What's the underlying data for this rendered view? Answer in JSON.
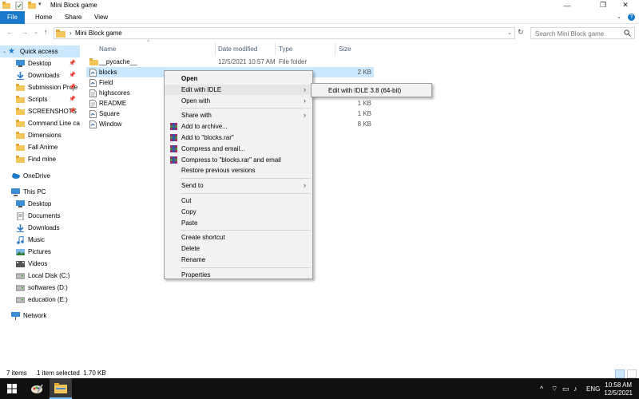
{
  "window": {
    "title": "Mini Block game",
    "controls": {
      "minimize": "—",
      "maximize": "❐",
      "close": "✕"
    }
  },
  "ribbon": {
    "tabs": [
      "File",
      "Home",
      "Share",
      "View"
    ],
    "help_icon": "?"
  },
  "address": {
    "path": "Mini Block game",
    "search_placeholder": "Search Mini Block game"
  },
  "nav": {
    "quick_access": "Quick access",
    "items": [
      {
        "label": "Desktop",
        "icon": "desktop-icon",
        "pinned": true
      },
      {
        "label": "Downloads",
        "icon": "download-icon",
        "pinned": true
      },
      {
        "label": "Submission Proje",
        "icon": "folder-icon",
        "pinned": true
      },
      {
        "label": "Scripts",
        "icon": "folder-icon",
        "pinned": true
      },
      {
        "label": "SCREENSHOTS",
        "icon": "folder-icon",
        "pinned": true
      },
      {
        "label": "Command Line calc",
        "icon": "folder-icon",
        "pinned": false
      },
      {
        "label": "Dimensions",
        "icon": "folder-icon",
        "pinned": false
      },
      {
        "label": "Fall Anime",
        "icon": "folder-icon",
        "pinned": false
      },
      {
        "label": "Find mine",
        "icon": "folder-icon",
        "pinned": false
      }
    ],
    "onedrive": "OneDrive",
    "this_pc": "This PC",
    "pc_items": [
      {
        "label": "Desktop",
        "icon": "desktop-icon"
      },
      {
        "label": "Documents",
        "icon": "documents-icon"
      },
      {
        "label": "Downloads",
        "icon": "download-icon"
      },
      {
        "label": "Music",
        "icon": "music-icon"
      },
      {
        "label": "Pictures",
        "icon": "pictures-icon"
      },
      {
        "label": "Videos",
        "icon": "videos-icon"
      },
      {
        "label": "Local Disk (C:)",
        "icon": "disk-icon"
      },
      {
        "label": "softwares (D:)",
        "icon": "disk-icon"
      },
      {
        "label": "education (E:)",
        "icon": "disk-icon"
      }
    ],
    "network": "Network"
  },
  "files": {
    "columns": [
      "Name",
      "Date modified",
      "Type",
      "Size"
    ],
    "rows": [
      {
        "name": "__pycache__",
        "date": "12/5/2021 10:57 AM",
        "type": "File folder",
        "size": "",
        "icon": "folder-icon"
      },
      {
        "name": "blocks",
        "date": "",
        "type": "",
        "size": "2 KB",
        "icon": "python-file-icon",
        "selected": true
      },
      {
        "name": "Field",
        "date": "",
        "type": "",
        "size": "",
        "icon": "python-file-icon"
      },
      {
        "name": "highscores",
        "date": "",
        "type": "",
        "size": "",
        "icon": "text-file-icon"
      },
      {
        "name": "README",
        "date": "",
        "type": "nt",
        "size": "1 KB",
        "icon": "text-file-icon"
      },
      {
        "name": "Square",
        "date": "",
        "type": "",
        "size": "1 KB",
        "icon": "python-file-icon"
      },
      {
        "name": "Window",
        "date": "",
        "type": "",
        "size": "8 KB",
        "icon": "python-file-icon"
      }
    ]
  },
  "context_menu": {
    "items": [
      {
        "label": "Open",
        "bold": true
      },
      {
        "label": "Edit with IDLE",
        "submenu": true,
        "highlighted": true
      },
      {
        "label": "Open with",
        "submenu": true
      },
      {
        "separator": true
      },
      {
        "label": "Share with",
        "submenu": true
      },
      {
        "label": "Add to archive...",
        "icon": "winrar-icon"
      },
      {
        "label": "Add to \"blocks.rar\"",
        "icon": "winrar-icon"
      },
      {
        "label": "Compress and email...",
        "icon": "winrar-icon"
      },
      {
        "label": "Compress to \"blocks.rar\" and email",
        "icon": "winrar-icon"
      },
      {
        "label": "Restore previous versions"
      },
      {
        "separator": true
      },
      {
        "label": "Send to",
        "submenu": true
      },
      {
        "separator": true
      },
      {
        "label": "Cut"
      },
      {
        "label": "Copy"
      },
      {
        "label": "Paste"
      },
      {
        "separator": true
      },
      {
        "label": "Create shortcut"
      },
      {
        "label": "Delete"
      },
      {
        "label": "Rename"
      },
      {
        "separator": true
      },
      {
        "label": "Properties"
      }
    ],
    "submenu": {
      "label": "Edit with IDLE 3.8 (64-bit)"
    }
  },
  "status": {
    "item_count": "7 items",
    "selection": "1 item selected  1.70 KB"
  },
  "taskbar": {
    "language": "ENG",
    "time": "10:58 AM",
    "date": "12/5/2021"
  },
  "colors": {
    "accent": "#1979ca",
    "selection": "#cce8ff",
    "folder": "#f3c65c",
    "taskbar": "#101010"
  }
}
